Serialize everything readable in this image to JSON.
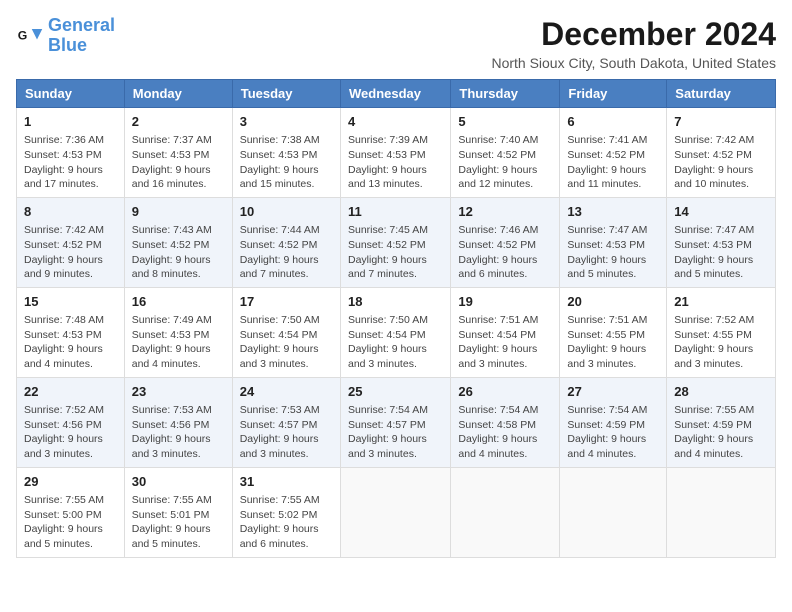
{
  "header": {
    "logo_line1": "General",
    "logo_line2": "Blue",
    "month_title": "December 2024",
    "location": "North Sioux City, South Dakota, United States"
  },
  "weekdays": [
    "Sunday",
    "Monday",
    "Tuesday",
    "Wednesday",
    "Thursday",
    "Friday",
    "Saturday"
  ],
  "weeks": [
    [
      {
        "day": "1",
        "info": "Sunrise: 7:36 AM\nSunset: 4:53 PM\nDaylight: 9 hours and 17 minutes."
      },
      {
        "day": "2",
        "info": "Sunrise: 7:37 AM\nSunset: 4:53 PM\nDaylight: 9 hours and 16 minutes."
      },
      {
        "day": "3",
        "info": "Sunrise: 7:38 AM\nSunset: 4:53 PM\nDaylight: 9 hours and 15 minutes."
      },
      {
        "day": "4",
        "info": "Sunrise: 7:39 AM\nSunset: 4:53 PM\nDaylight: 9 hours and 13 minutes."
      },
      {
        "day": "5",
        "info": "Sunrise: 7:40 AM\nSunset: 4:52 PM\nDaylight: 9 hours and 12 minutes."
      },
      {
        "day": "6",
        "info": "Sunrise: 7:41 AM\nSunset: 4:52 PM\nDaylight: 9 hours and 11 minutes."
      },
      {
        "day": "7",
        "info": "Sunrise: 7:42 AM\nSunset: 4:52 PM\nDaylight: 9 hours and 10 minutes."
      }
    ],
    [
      {
        "day": "8",
        "info": "Sunrise: 7:42 AM\nSunset: 4:52 PM\nDaylight: 9 hours and 9 minutes."
      },
      {
        "day": "9",
        "info": "Sunrise: 7:43 AM\nSunset: 4:52 PM\nDaylight: 9 hours and 8 minutes."
      },
      {
        "day": "10",
        "info": "Sunrise: 7:44 AM\nSunset: 4:52 PM\nDaylight: 9 hours and 7 minutes."
      },
      {
        "day": "11",
        "info": "Sunrise: 7:45 AM\nSunset: 4:52 PM\nDaylight: 9 hours and 7 minutes."
      },
      {
        "day": "12",
        "info": "Sunrise: 7:46 AM\nSunset: 4:52 PM\nDaylight: 9 hours and 6 minutes."
      },
      {
        "day": "13",
        "info": "Sunrise: 7:47 AM\nSunset: 4:53 PM\nDaylight: 9 hours and 5 minutes."
      },
      {
        "day": "14",
        "info": "Sunrise: 7:47 AM\nSunset: 4:53 PM\nDaylight: 9 hours and 5 minutes."
      }
    ],
    [
      {
        "day": "15",
        "info": "Sunrise: 7:48 AM\nSunset: 4:53 PM\nDaylight: 9 hours and 4 minutes."
      },
      {
        "day": "16",
        "info": "Sunrise: 7:49 AM\nSunset: 4:53 PM\nDaylight: 9 hours and 4 minutes."
      },
      {
        "day": "17",
        "info": "Sunrise: 7:50 AM\nSunset: 4:54 PM\nDaylight: 9 hours and 3 minutes."
      },
      {
        "day": "18",
        "info": "Sunrise: 7:50 AM\nSunset: 4:54 PM\nDaylight: 9 hours and 3 minutes."
      },
      {
        "day": "19",
        "info": "Sunrise: 7:51 AM\nSunset: 4:54 PM\nDaylight: 9 hours and 3 minutes."
      },
      {
        "day": "20",
        "info": "Sunrise: 7:51 AM\nSunset: 4:55 PM\nDaylight: 9 hours and 3 minutes."
      },
      {
        "day": "21",
        "info": "Sunrise: 7:52 AM\nSunset: 4:55 PM\nDaylight: 9 hours and 3 minutes."
      }
    ],
    [
      {
        "day": "22",
        "info": "Sunrise: 7:52 AM\nSunset: 4:56 PM\nDaylight: 9 hours and 3 minutes."
      },
      {
        "day": "23",
        "info": "Sunrise: 7:53 AM\nSunset: 4:56 PM\nDaylight: 9 hours and 3 minutes."
      },
      {
        "day": "24",
        "info": "Sunrise: 7:53 AM\nSunset: 4:57 PM\nDaylight: 9 hours and 3 minutes."
      },
      {
        "day": "25",
        "info": "Sunrise: 7:54 AM\nSunset: 4:57 PM\nDaylight: 9 hours and 3 minutes."
      },
      {
        "day": "26",
        "info": "Sunrise: 7:54 AM\nSunset: 4:58 PM\nDaylight: 9 hours and 4 minutes."
      },
      {
        "day": "27",
        "info": "Sunrise: 7:54 AM\nSunset: 4:59 PM\nDaylight: 9 hours and 4 minutes."
      },
      {
        "day": "28",
        "info": "Sunrise: 7:55 AM\nSunset: 4:59 PM\nDaylight: 9 hours and 4 minutes."
      }
    ],
    [
      {
        "day": "29",
        "info": "Sunrise: 7:55 AM\nSunset: 5:00 PM\nDaylight: 9 hours and 5 minutes."
      },
      {
        "day": "30",
        "info": "Sunrise: 7:55 AM\nSunset: 5:01 PM\nDaylight: 9 hours and 5 minutes."
      },
      {
        "day": "31",
        "info": "Sunrise: 7:55 AM\nSunset: 5:02 PM\nDaylight: 9 hours and 6 minutes."
      },
      {
        "day": "",
        "info": ""
      },
      {
        "day": "",
        "info": ""
      },
      {
        "day": "",
        "info": ""
      },
      {
        "day": "",
        "info": ""
      }
    ]
  ]
}
